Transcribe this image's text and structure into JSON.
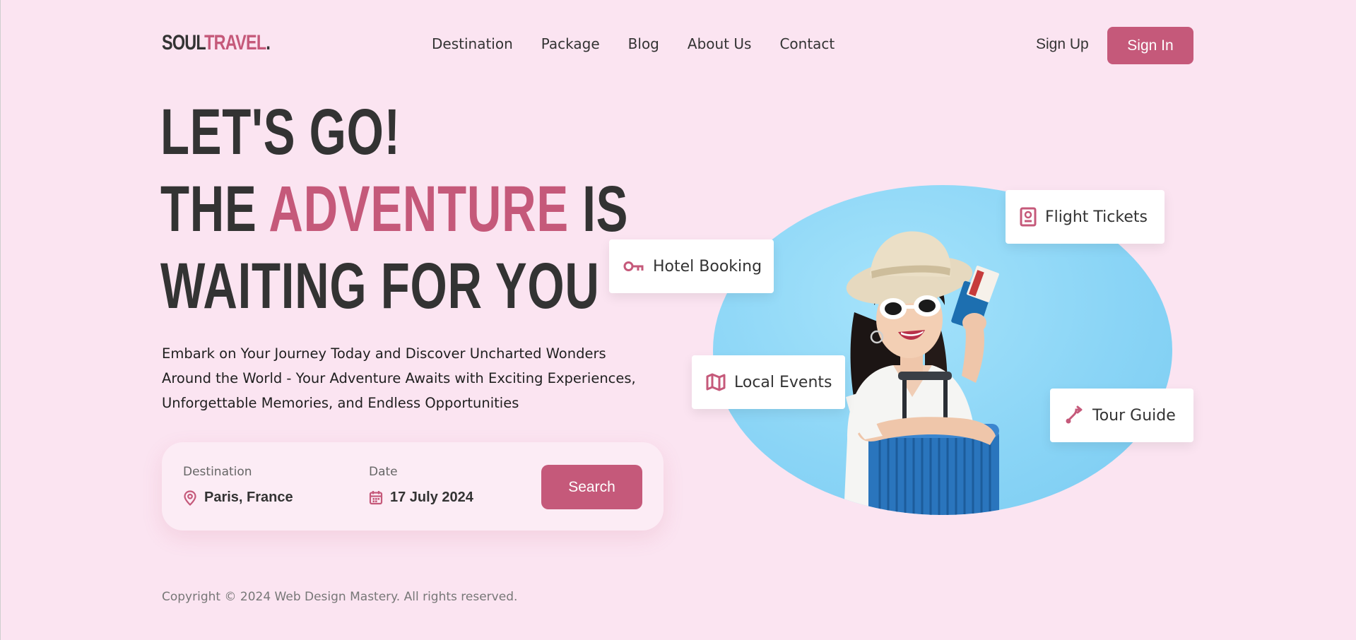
{
  "brand": {
    "name_part1": "SOUL",
    "name_part2": "TRAVEL",
    "name_dot": "."
  },
  "nav": {
    "items": [
      {
        "label": "Destination"
      },
      {
        "label": "Package"
      },
      {
        "label": "Blog"
      },
      {
        "label": "About Us"
      },
      {
        "label": "Contact"
      }
    ]
  },
  "auth": {
    "signup_label": "Sign Up",
    "signin_label": "Sign In"
  },
  "hero": {
    "line1": "LET'S GO!",
    "line2_pre": "THE ",
    "line2_accent": "ADVENTURE",
    "line2_post": " IS",
    "line3": "WAITING FOR YOU",
    "description": "Embark on Your Journey Today and Discover Uncharted Wonders Around the World - Your Adventure Awaits with Exciting Experiences, Unforgettable Memories, and Endless Opportunities"
  },
  "search": {
    "destination_label": "Destination",
    "destination_value": "Paris, France",
    "date_label": "Date",
    "date_value": "17 July 2024",
    "button_label": "Search"
  },
  "features": {
    "hotel": {
      "label": "Hotel Booking",
      "icon": "key-icon"
    },
    "flight": {
      "label": "Flight Tickets",
      "icon": "passport-icon"
    },
    "events": {
      "label": "Local Events",
      "icon": "map-icon"
    },
    "guide": {
      "label": "Tour Guide",
      "icon": "route-icon"
    }
  },
  "footer": {
    "copyright": "Copyright © 2024 Web Design Mastery. All rights reserved."
  },
  "colors": {
    "background": "#fbe4f1",
    "accent": "#c5597a",
    "text": "#333333",
    "hero_circle": "#8bd5f6"
  }
}
